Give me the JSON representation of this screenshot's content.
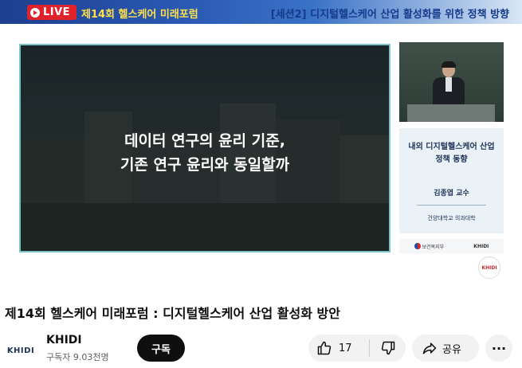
{
  "player": {
    "live_label": "LIVE",
    "banner_left": "제14회 헬스케어 미래포럼",
    "banner_right": "[세션2] 디지털헬스케어 산업 활성화를 위한 정책 방향",
    "slide_caption_line1": "데이터 연구의 윤리 기준,",
    "slide_caption_line2": "기존 연구 윤리와 동일할까",
    "speaker_card": {
      "title_line1": "내외 디지털헬스케어 산업",
      "title_line2": "정책 동향",
      "name": "김종엽 교수",
      "affiliation": "건양대학교 의과대학"
    },
    "logos": {
      "ministry": "보건복지부",
      "khidi": "KHIDI"
    },
    "watermark": "KHIDI"
  },
  "video": {
    "title": "제14회 헬스케어 미래포럼 : 디지털헬스케어 산업 활성화 방안"
  },
  "channel": {
    "avatar_text": "KHIDI",
    "name": "KHIDI",
    "subscribers": "구독자 9.03천명",
    "subscribe_label": "구독"
  },
  "actions": {
    "like_count": "17",
    "share_label": "공유",
    "more_label": "···"
  },
  "colors": {
    "live_red": "#e0232a",
    "banner_yellow": "#ffe04a",
    "banner_navy": "#153a8c",
    "pill_bg": "#f2f2f2",
    "subscribe_bg": "#0f0f0f"
  },
  "icons": [
    "play-icon",
    "thumbs-up-icon",
    "thumbs-down-icon",
    "share-icon",
    "more-icon"
  ]
}
